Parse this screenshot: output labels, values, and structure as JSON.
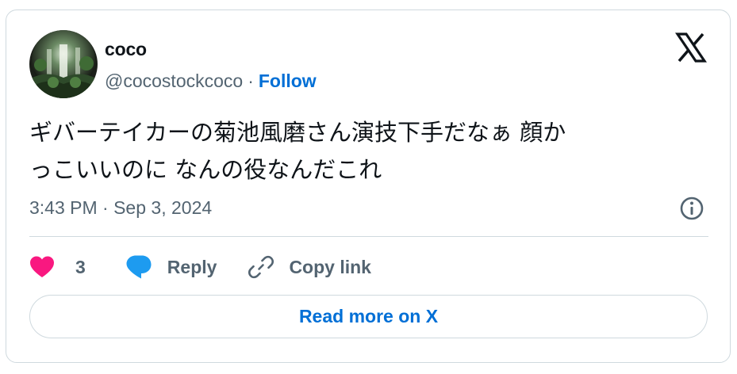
{
  "author": {
    "name": "coco",
    "handle": "@cocostockcoco",
    "separator": "·",
    "follow_label": "Follow"
  },
  "tweet": {
    "text": "ギバーテイカーの菊池風磨さん演技下手だなぁ 顔か\nっこいいのに なんの役なんだこれ",
    "timestamp": "3:43 PM · Sep 3, 2024"
  },
  "actions": {
    "like_count": "3",
    "reply_label": "Reply",
    "copy_link_label": "Copy link"
  },
  "read_more_label": "Read more on X",
  "colors": {
    "like": "#f91880",
    "reply": "#1d9bf0",
    "link": "#006fd6",
    "muted": "#536471",
    "text": "#0f1419",
    "border": "#cfd9de"
  },
  "icons": [
    "x-logo-icon",
    "info-icon",
    "heart-icon",
    "reply-bubble-icon",
    "link-icon"
  ]
}
